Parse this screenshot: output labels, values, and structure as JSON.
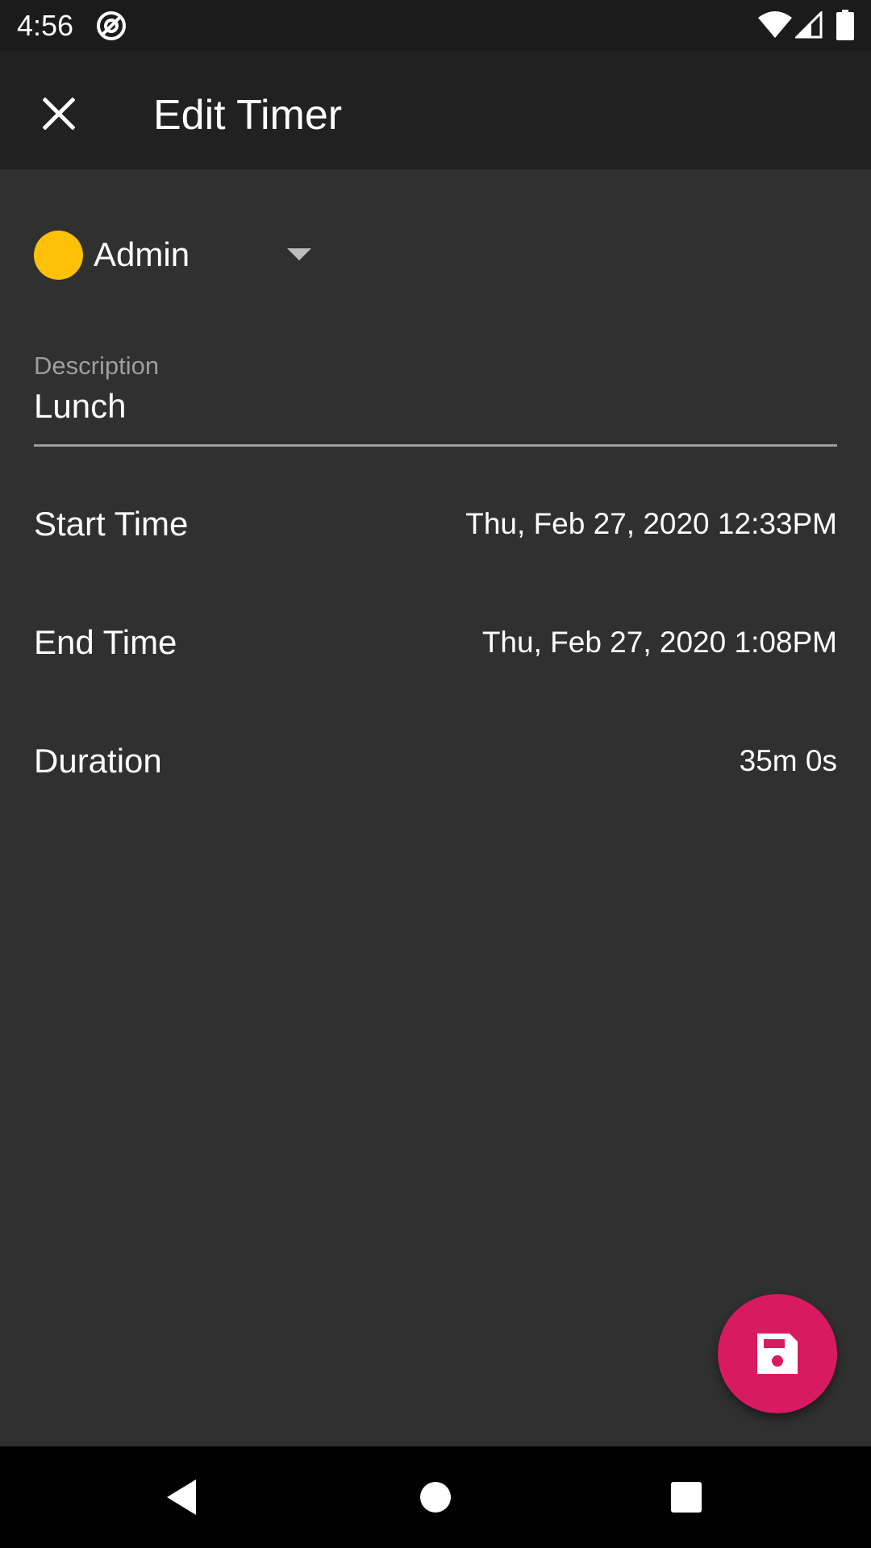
{
  "status_bar": {
    "time": "4:56",
    "icons": [
      "at-sign-icon",
      "wifi-icon",
      "cell-signal-icon",
      "battery-icon"
    ]
  },
  "app_bar": {
    "close_icon": "close-icon",
    "title": "Edit Timer"
  },
  "project": {
    "name": "Admin",
    "color": "#ffc107",
    "dropdown_icon": "chevron-down-icon"
  },
  "description": {
    "label": "Description",
    "value": "Lunch"
  },
  "fields": {
    "start_time": {
      "label": "Start Time",
      "value": "Thu, Feb 27, 2020 12:33PM"
    },
    "end_time": {
      "label": "End Time",
      "value": "Thu, Feb 27, 2020 1:08PM"
    },
    "duration": {
      "label": "Duration",
      "value": "35m 0s"
    }
  },
  "fab": {
    "icon": "save-icon",
    "color": "#d81b60"
  },
  "nav_bar": {
    "icons": [
      "back-icon",
      "home-icon",
      "recents-icon"
    ]
  }
}
